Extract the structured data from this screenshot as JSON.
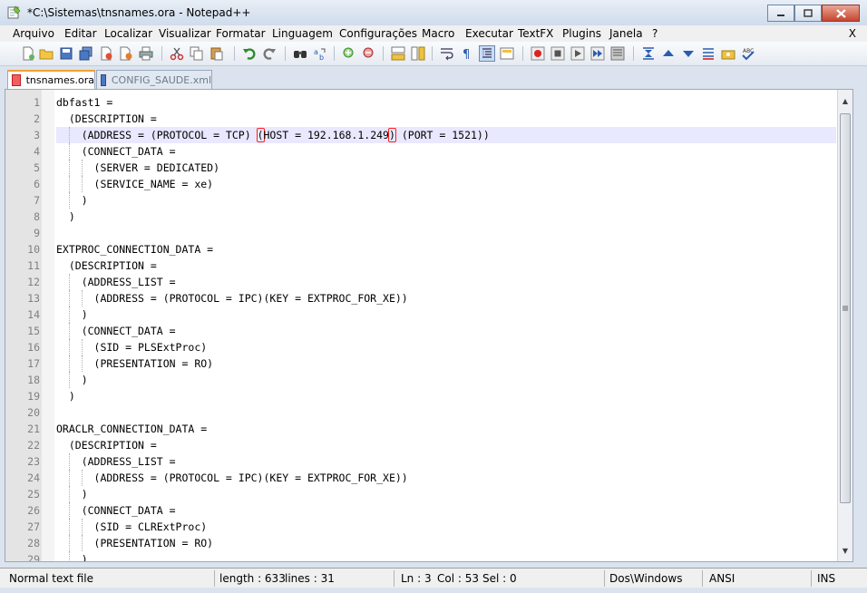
{
  "window": {
    "title": "*C:\\Sistemas\\tnsnames.ora - Notepad++"
  },
  "menu": {
    "items": [
      "Arquivo",
      "Editar",
      "Localizar",
      "Visualizar",
      "Formatar",
      "Linguagem",
      "Configurações",
      "Macro",
      "Executar",
      "TextFX",
      "Plugins",
      "Janela",
      "?"
    ],
    "close_doc": "X"
  },
  "toolbar": {
    "icons": [
      "new-file-icon",
      "open-file-icon",
      "save-icon",
      "save-all-icon",
      "close-icon",
      "close-all-icon",
      "print-icon",
      "cut-icon",
      "copy-icon",
      "paste-icon",
      "undo-icon",
      "redo-icon",
      "find-icon",
      "replace-icon",
      "zoom-in-icon",
      "zoom-out-icon",
      "sync-vertical-icon",
      "sync-horizontal-icon",
      "word-wrap-icon",
      "show-all-chars-icon",
      "indent-guide-icon",
      "document-map-icon",
      "record-macro-icon",
      "stop-record-icon",
      "play-macro-icon",
      "play-multiple-icon",
      "save-macro-icon",
      "collapse-icon",
      "up-icon",
      "down-icon",
      "tfx-icon",
      "spell-icon",
      "abc-check-icon"
    ]
  },
  "tabs": [
    {
      "label": "tnsnames.ora",
      "active": true
    },
    {
      "label": "CONFIG_SAUDE.xml",
      "active": false
    }
  ],
  "editor": {
    "current_line": 3,
    "lines": [
      "dbfast1 =",
      "  (DESCRIPTION =",
      "    (ADDRESS = (PROTOCOL = TCP) (HOST = 192.168.1.249) (PORT = 1521))",
      "    (CONNECT_DATA =",
      "      (SERVER = DEDICATED)",
      "      (SERVICE_NAME = xe)",
      "    )",
      "  )",
      "",
      "EXTPROC_CONNECTION_DATA =",
      "  (DESCRIPTION =",
      "    (ADDRESS_LIST =",
      "      (ADDRESS = (PROTOCOL = IPC)(KEY = EXTPROC_FOR_XE))",
      "    )",
      "    (CONNECT_DATA =",
      "      (SID = PLSExtProc)",
      "      (PRESENTATION = RO)",
      "    )",
      "  )",
      "",
      "ORACLR_CONNECTION_DATA =",
      "  (DESCRIPTION =",
      "    (ADDRESS_LIST =",
      "      (ADDRESS = (PROTOCOL = IPC)(KEY = EXTPROC_FOR_XE))",
      "    )",
      "    (CONNECT_DATA =",
      "      (SID = CLRExtProc)",
      "      (PRESENTATION = RO)",
      "    )"
    ]
  },
  "status": {
    "file_type": "Normal text file",
    "length": "length : 633",
    "lines": "lines : 31",
    "ln": "Ln : 3",
    "col": "Col : 53",
    "sel": "Sel : 0",
    "eol": "Dos\\Windows",
    "encoding": "ANSI",
    "mode": "INS"
  },
  "colors": {
    "current_line_bg": "#e8e8ff",
    "brace_highlight": "#ff2020",
    "line_number_fg": "#808080",
    "tab_accent": "#f0a030"
  }
}
